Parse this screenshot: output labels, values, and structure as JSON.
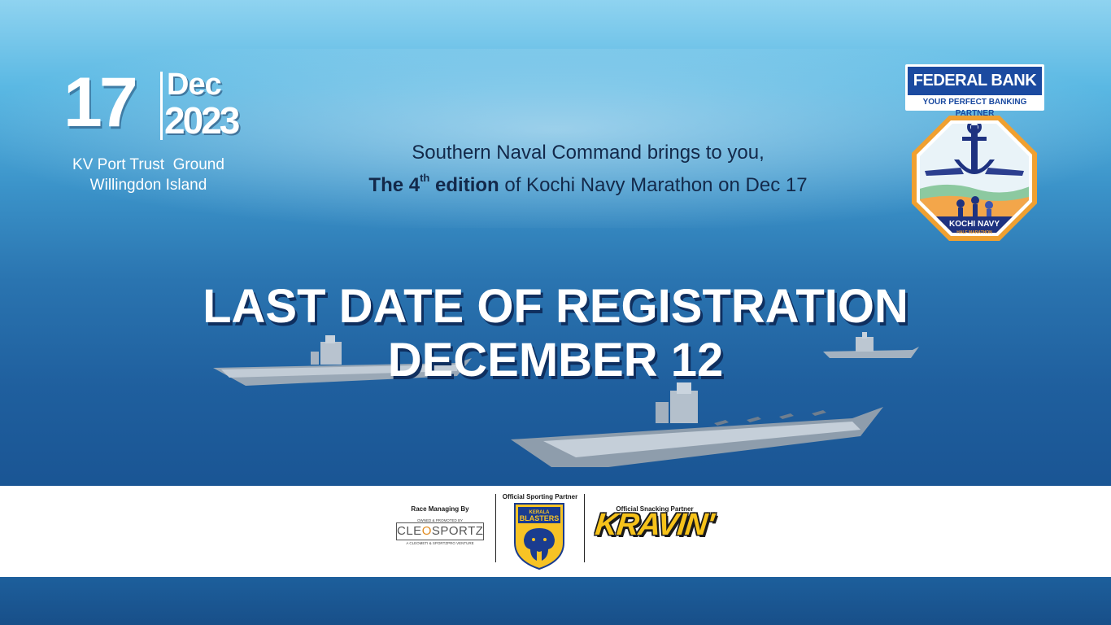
{
  "event": {
    "day": "17",
    "month": "Dec",
    "year": "2023",
    "venue_line1": "KV Port Trust  Ground",
    "venue_line2": "Willingdon Island"
  },
  "headline": {
    "line1": "Southern Naval Command brings to you,",
    "line2_bold": "The 4",
    "line2_sup": "th",
    "line2_bold_tail": " edition",
    "line2_rest": " of Kochi Navy Marathon on Dec 17"
  },
  "deadline": {
    "line1": "LAST DATE OF REGISTRATION",
    "line2": "DECEMBER 12"
  },
  "sponsor": {
    "name": "FEDERAL BANK",
    "tagline": "YOUR PERFECT BANKING PARTNER"
  },
  "event_logo": {
    "line1": "KOCHI",
    "line2": "NAVY",
    "line3": "HALF MARATHON"
  },
  "partners": {
    "managing_caption": "Race Managing By",
    "managing_pre": "OWNED & PROMOTED BY",
    "managing_name_a": "CLE",
    "managing_name_b": "O",
    "managing_name_c": "SPORTZ",
    "managing_sub": "A CLEOMETI & SPORTZPRO VENTURE",
    "sporting_caption": "Official Sporting Partner",
    "sporting_line1": "KERALA",
    "sporting_line2": "BLASTERS",
    "snacking_caption": "Official Snacking Partner",
    "snacking_name": "KRAVIN'"
  },
  "colors": {
    "sea_dark": "#154c88",
    "sky_light": "#8fd3f0",
    "headline_text": "#13294a",
    "federal_blue": "#1b4aa0",
    "navy_logo_orange": "#f0a030",
    "kravin_yellow": "#f6c21a",
    "blasters_yellow": "#f7c325",
    "blasters_blue": "#1a3c8f"
  }
}
